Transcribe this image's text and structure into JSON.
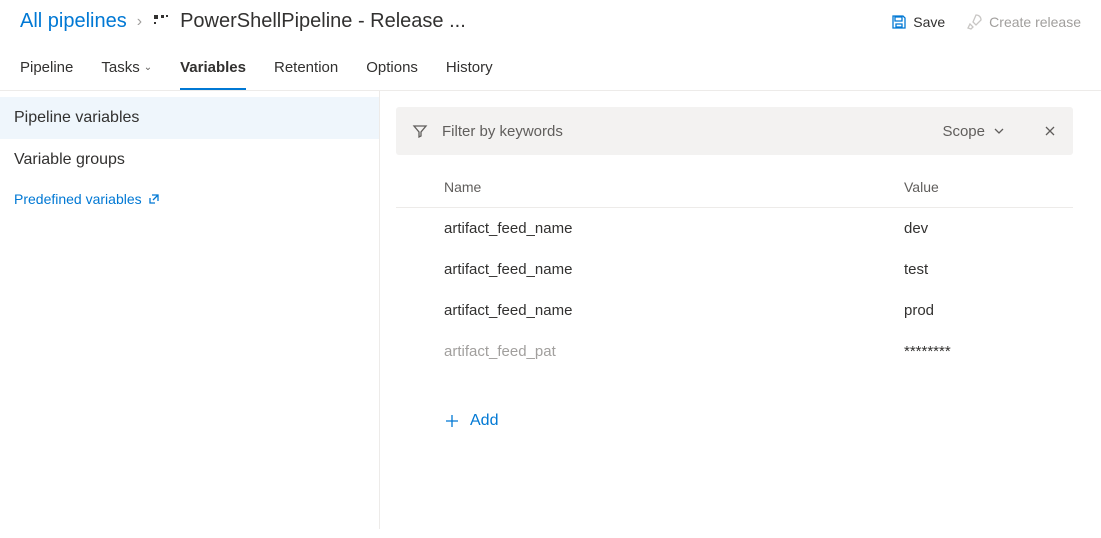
{
  "breadcrumb": {
    "root": "All pipelines",
    "title": "PowerShellPipeline - Release ..."
  },
  "actions": {
    "save": "Save",
    "create_release": "Create release"
  },
  "tabs": {
    "pipeline": "Pipeline",
    "tasks": "Tasks",
    "variables": "Variables",
    "retention": "Retention",
    "options": "Options",
    "history": "History"
  },
  "sidebar": {
    "pipeline_vars": "Pipeline variables",
    "variable_groups": "Variable groups",
    "predefined": "Predefined variables"
  },
  "filter": {
    "placeholder": "Filter by keywords",
    "scope_label": "Scope"
  },
  "table": {
    "head_name": "Name",
    "head_value": "Value",
    "rows": [
      {
        "name": "artifact_feed_name",
        "value": "dev",
        "muted": false
      },
      {
        "name": "artifact_feed_name",
        "value": "test",
        "muted": false
      },
      {
        "name": "artifact_feed_name",
        "value": "prod",
        "muted": false
      },
      {
        "name": "artifact_feed_pat",
        "value": "********",
        "muted": true
      }
    ]
  },
  "add_label": "Add"
}
